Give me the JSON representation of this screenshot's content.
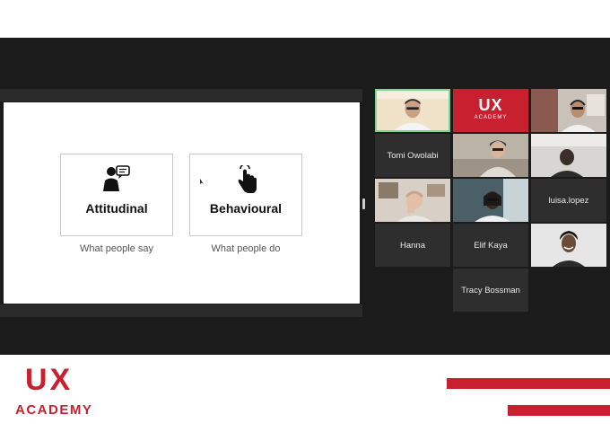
{
  "slide": {
    "cards": [
      {
        "label": "Attitudinal",
        "caption": "What people say",
        "icon": "person-speech-icon"
      },
      {
        "label": "Behavioural",
        "caption": "What people do",
        "icon": "hand-tap-icon"
      }
    ]
  },
  "participants": [
    {
      "type": "video",
      "desc": "man-glasses"
    },
    {
      "type": "logo",
      "logo_top": "UX",
      "logo_bottom": "ACADEMY"
    },
    {
      "type": "video",
      "desc": "man-headset"
    },
    {
      "type": "name",
      "name": "Tomi Owolabi"
    },
    {
      "type": "video",
      "desc": "man-hat"
    },
    {
      "type": "video",
      "desc": "person-dim"
    },
    {
      "type": "video",
      "desc": "person-hand-face"
    },
    {
      "type": "video",
      "desc": "woman-glasses"
    },
    {
      "type": "name",
      "name": "luisa.lopez"
    },
    {
      "type": "name",
      "name": "Hanna"
    },
    {
      "type": "name",
      "name": "Elif Kaya"
    },
    {
      "type": "video",
      "desc": "smiling-person"
    },
    {
      "type": "name",
      "name": "Tracy Bossman"
    }
  ],
  "branding": {
    "ux": "UX",
    "academy": "ACADEMY",
    "color": "#c8202f"
  }
}
